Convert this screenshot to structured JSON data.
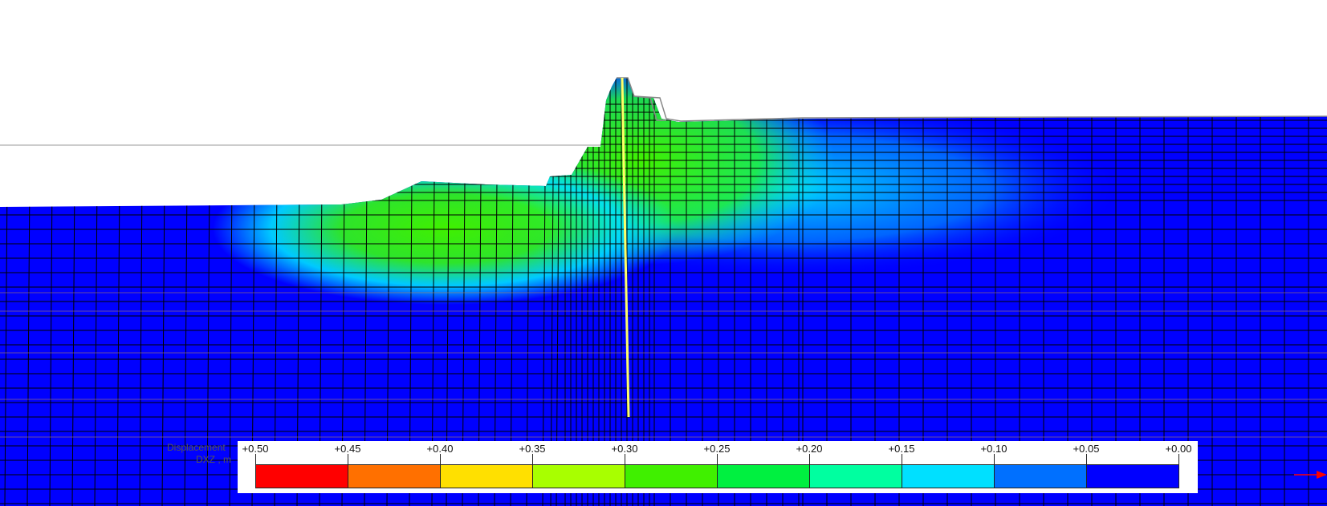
{
  "legend": {
    "title_line1": "Displacement",
    "title_line2": "DXZ , m",
    "ticks": [
      "+0.50",
      "+0.45",
      "+0.40",
      "+0.35",
      "+0.30",
      "+0.25",
      "+0.20",
      "+0.15",
      "+0.10",
      "+0.05",
      "+0.00"
    ],
    "bands": [
      {
        "from": 0.5,
        "to": 0.45,
        "color": "#ff0000"
      },
      {
        "from": 0.45,
        "to": 0.4,
        "color": "#ff7000"
      },
      {
        "from": 0.4,
        "to": 0.35,
        "color": "#ffe000"
      },
      {
        "from": 0.35,
        "to": 0.3,
        "color": "#a8ff00"
      },
      {
        "from": 0.3,
        "to": 0.25,
        "color": "#40f000"
      },
      {
        "from": 0.25,
        "to": 0.2,
        "color": "#00f040"
      },
      {
        "from": 0.2,
        "to": 0.15,
        "color": "#00ffa0"
      },
      {
        "from": 0.15,
        "to": 0.1,
        "color": "#00e0ff"
      },
      {
        "from": 0.1,
        "to": 0.05,
        "color": "#0070ff"
      },
      {
        "from": 0.05,
        "to": 0.0,
        "color": "#0000ff"
      }
    ]
  },
  "colors": {
    "ground_blue": "#0000ff",
    "mesh_line": "#000000",
    "pile": "#ffff66"
  }
}
